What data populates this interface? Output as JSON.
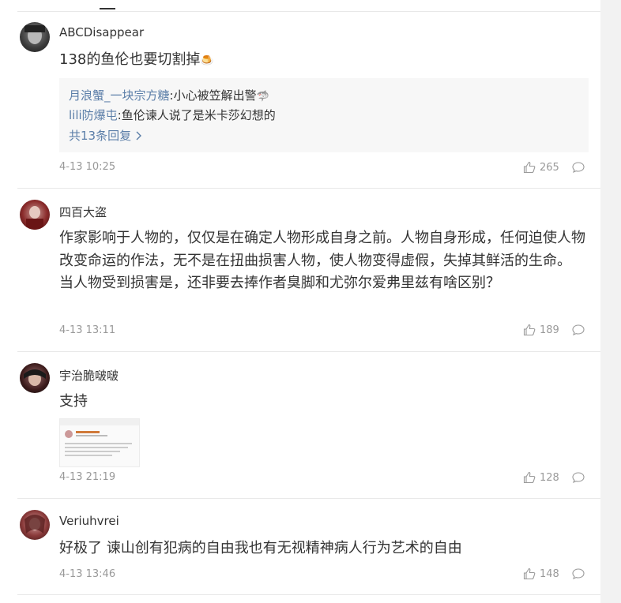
{
  "comments": [
    {
      "username": "ABCDisappear",
      "text": "138的鱼伦也要切割掉",
      "emoji": "🍮",
      "replies": [
        {
          "user": "月浪蟹_一块宗方糖",
          "sep": ":",
          "text": "小心被笠解出警",
          "emoji": "🦈"
        },
        {
          "user": "lili防爆屯",
          "sep": ":",
          "text": "鱼伦谏人说了是米卡莎幻想的"
        }
      ],
      "more_replies": "共13条回复",
      "time": "4-13 10:25",
      "likes": "265"
    },
    {
      "username": "四百大盗",
      "text": "作家影响于人物的，仅仅是在确定人物形成自身之前。人物自身形成，任何迫使人物改变命运的作法，无不是在扭曲损害人物，使人物变得虚假，失掉其鲜活的生命。 当人物受到损害是，还非要去捧作者臭脚和尤弥尔爱弗里兹有啥区别？",
      "time": "4-13 13:11",
      "likes": "189"
    },
    {
      "username": "宇治脆啵啵",
      "text": "支持",
      "time": "4-13 21:19",
      "likes": "128"
    },
    {
      "username": "Veriuhvrei",
      "text": "好极了 谏山创有犯病的自由我也有无视精神病人行为艺术的自由",
      "time": "4-13 13:46",
      "likes": "148"
    }
  ],
  "colors": {
    "link": "#5b7ea8",
    "meta": "#999999",
    "reply_bg": "#f7f7f7"
  },
  "icons": [
    "thumbs-up-icon",
    "comment-icon"
  ]
}
